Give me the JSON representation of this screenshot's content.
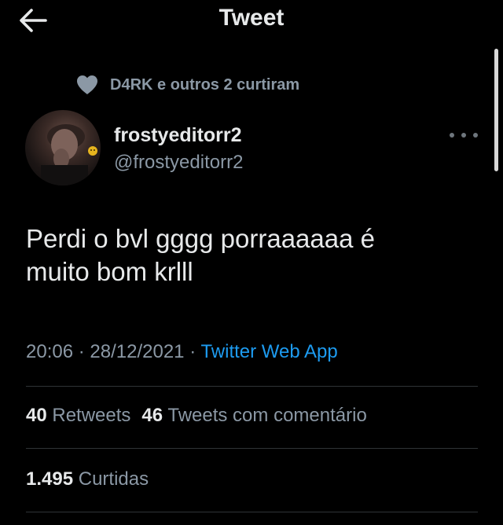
{
  "header": {
    "title": "Tweet",
    "back_icon": "arrow-left-icon"
  },
  "social_context": {
    "icon": "heart-icon",
    "text": "D4RK e outros 2 curtiram"
  },
  "author": {
    "name": "frostyeditorr2",
    "handle": "@frostyeditorr2",
    "more_icon": "more-horizontal-icon"
  },
  "tweet": {
    "text": "Perdi o bvl gggg porraaaaaa é\nmuito bom krlll",
    "time": "20:06",
    "separator_1": "·",
    "date": "28/12/2021",
    "separator_2": "·",
    "source": "Twitter Web App"
  },
  "stats": {
    "retweets_count": "40",
    "retweets_label": "Retweets",
    "quotes_count": "46",
    "quotes_label": "Tweets com comentário",
    "likes_count": "1.495",
    "likes_label": "Curtidas"
  },
  "colors": {
    "background": "#000000",
    "text_primary": "#e7e9ea",
    "text_secondary": "#8b98a5",
    "link": "#1d9bf0",
    "divider": "#2f3336"
  }
}
